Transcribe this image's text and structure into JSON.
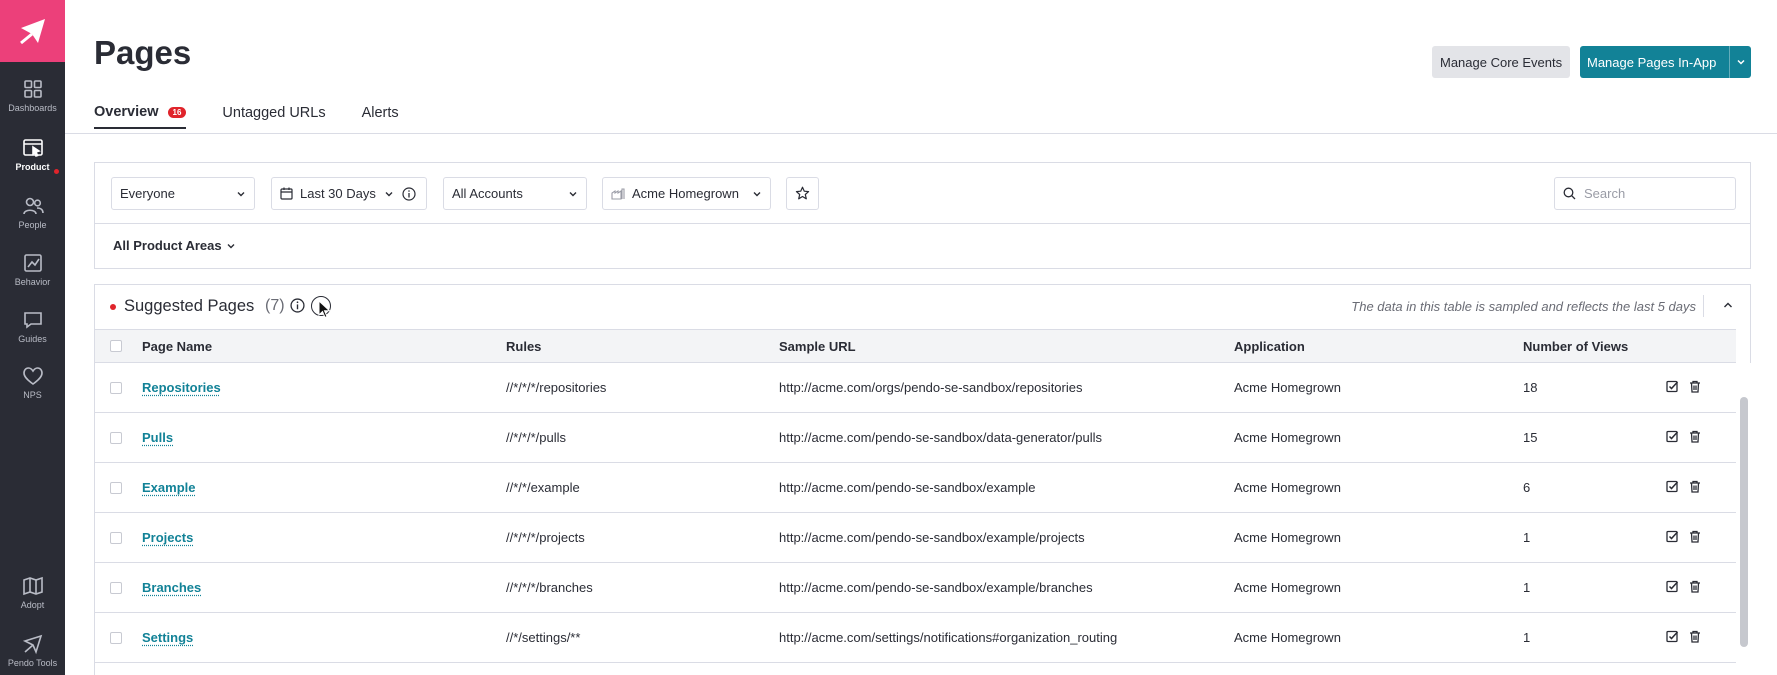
{
  "sidebar": {
    "items": [
      {
        "label": "Dashboards",
        "icon": "grid-icon"
      },
      {
        "label": "Product",
        "icon": "product-icon",
        "active": true
      },
      {
        "label": "People",
        "icon": "people-icon"
      },
      {
        "label": "Behavior",
        "icon": "chart-icon"
      },
      {
        "label": "Guides",
        "icon": "message-icon"
      },
      {
        "label": "NPS",
        "icon": "heart-icon"
      }
    ],
    "bottom_items": [
      {
        "label": "Adopt",
        "icon": "map-icon"
      },
      {
        "label": "Pendo Tools",
        "icon": "signpost-icon"
      }
    ]
  },
  "header": {
    "title": "Pages",
    "manage_core_events": "Manage Core Events",
    "manage_pages_in_app": "Manage Pages In-App"
  },
  "tabs": [
    {
      "label": "Overview",
      "badge": "16",
      "active": true
    },
    {
      "label": "Untagged URLs"
    },
    {
      "label": "Alerts"
    }
  ],
  "filters": {
    "segment": "Everyone",
    "date_range": "Last 30 Days",
    "accounts": "All Accounts",
    "application": "Acme Homegrown",
    "search_placeholder": "Search",
    "product_areas": "All Product Areas"
  },
  "suggested_pages": {
    "title": "Suggested Pages",
    "count": "(7)",
    "note": "The data in this table is sampled and reflects the last 5 days",
    "columns": [
      "Page Name",
      "Rules",
      "Sample URL",
      "Application",
      "Number of Views"
    ],
    "rows": [
      {
        "name": "Repositories",
        "rule": "//*/*/*/repositories",
        "url": "http://acme.com/orgs/pendo-se-sandbox/repositories",
        "app": "Acme Homegrown",
        "views": "18"
      },
      {
        "name": "Pulls",
        "rule": "//*/*/*/pulls",
        "url": "http://acme.com/pendo-se-sandbox/data-generator/pulls",
        "app": "Acme Homegrown",
        "views": "15"
      },
      {
        "name": "Example",
        "rule": "//*/*/example",
        "url": "http://acme.com/pendo-se-sandbox/example",
        "app": "Acme Homegrown",
        "views": "6"
      },
      {
        "name": "Projects",
        "rule": "//*/*/*/projects",
        "url": "http://acme.com/pendo-se-sandbox/example/projects",
        "app": "Acme Homegrown",
        "views": "1"
      },
      {
        "name": "Branches",
        "rule": "//*/*/*/branches",
        "url": "http://acme.com/pendo-se-sandbox/example/branches",
        "app": "Acme Homegrown",
        "views": "1"
      },
      {
        "name": "Settings",
        "rule": "//*/settings/**",
        "url": "http://acme.com/settings/notifications#organization_routing",
        "app": "Acme Homegrown",
        "views": "1"
      }
    ]
  },
  "colors": {
    "accent": "#128297",
    "brand": "#ec407a",
    "sidebar": "#2a2c35",
    "alert": "#e0242b"
  }
}
